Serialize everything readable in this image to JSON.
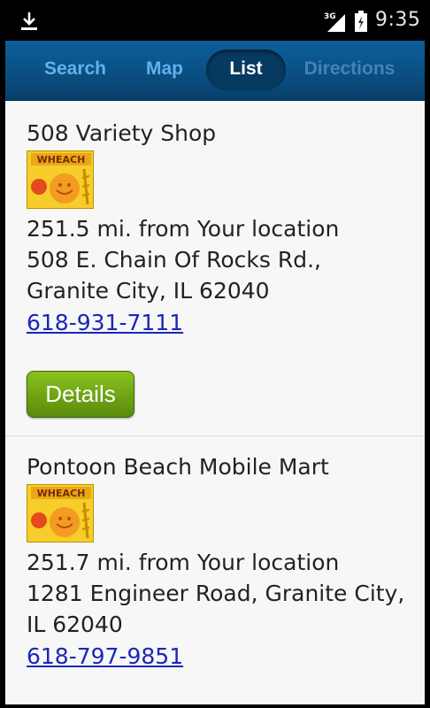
{
  "status_bar": {
    "time": "9:35",
    "network": "3G",
    "icons": [
      "download-icon",
      "signal-icon",
      "battery-icon"
    ]
  },
  "nav": {
    "tabs": [
      {
        "label": "Search",
        "active": false
      },
      {
        "label": "Map",
        "active": false
      },
      {
        "label": "List",
        "active": true
      },
      {
        "label": "Directions",
        "active": false
      }
    ]
  },
  "listings": [
    {
      "name": "508 Variety Shop",
      "logo": "wheach-product-logo",
      "distance": "251.5 mi. from Your location",
      "address_lines": [
        "508 E. Chain Of Rocks Rd.,",
        "Granite City, IL 62040"
      ],
      "phone": "618-931-7111",
      "button": "Details"
    },
    {
      "name": "Pontoon Beach Mobile Mart",
      "logo": "wheach-product-logo",
      "distance": "251.7 mi. from Your location",
      "address_lines": [
        "1281 Engineer Road, Granite City,",
        "IL 62040"
      ],
      "phone": "618-797-9851"
    }
  ],
  "colors": {
    "nav_bar": "#0a4f84",
    "tab_inactive": "#5fb2ea",
    "tab_active_bg": "#063a60",
    "link": "#1a27b8",
    "details_button": "#6ea313",
    "logo_yellow": "#f6cd2a"
  }
}
